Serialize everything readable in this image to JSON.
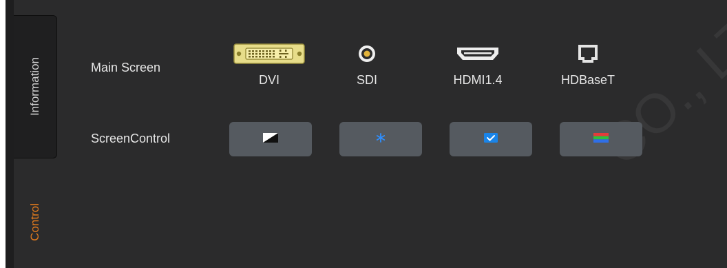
{
  "tabs": [
    {
      "label": "Information",
      "active": true
    },
    {
      "label": "Control",
      "active": false
    }
  ],
  "rows": {
    "main_screen_label": "Main Screen",
    "screen_control_label": "ScreenControl"
  },
  "ports": [
    {
      "label": "DVI",
      "icon": "dvi-connector-icon"
    },
    {
      "label": "SDI",
      "icon": "sdi-bnc-connector-icon"
    },
    {
      "label": "HDMI1.4",
      "icon": "hdmi-connector-icon"
    },
    {
      "label": "HDBaseT",
      "icon": "hdbaset-rj45-icon"
    }
  ],
  "controls": [
    {
      "icon": "blackout-icon"
    },
    {
      "icon": "freeze-icon"
    },
    {
      "icon": "normal-display-icon"
    },
    {
      "icon": "test-pattern-icon"
    }
  ],
  "watermark": {
    "text": "CO., LTD"
  },
  "colors": {
    "background": "#2b2b2c",
    "active_tab": "#1f1f20",
    "control_tab_text": "#e07a1e",
    "button": "#555a60",
    "freeze_icon": "#2f8fff",
    "checkbox": "#1a84e8"
  }
}
